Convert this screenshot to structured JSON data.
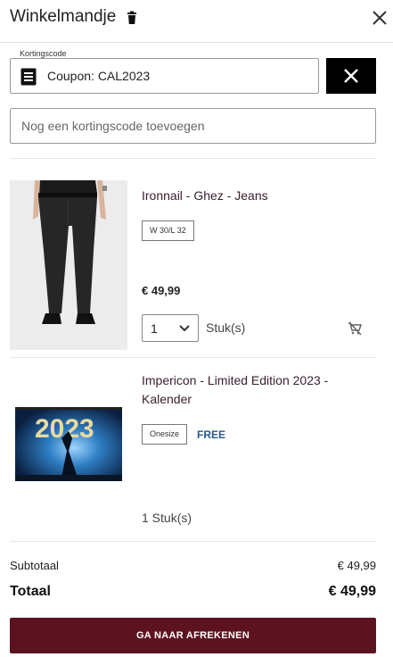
{
  "header": {
    "title": "Winkelmandje",
    "icons": [
      "trash-icon",
      "close-icon"
    ]
  },
  "coupon": {
    "legend": "Kortingscode",
    "applied": "Coupon: CAL2023",
    "icons": [
      "coupon-icon",
      "close-icon"
    ]
  },
  "code_input": {
    "placeholder": "Nog een kortingscode toevoegen",
    "value": ""
  },
  "items": [
    {
      "name": "Ironnail - Ghez - Jeans",
      "size": "W 30/L 32",
      "price": "€ 49,99",
      "quantity": "1",
      "unit": "Stuk(s)",
      "icons": [
        "jeans-product-image",
        "cart-remove-icon",
        "chevron-down-icon"
      ]
    },
    {
      "name": "Impericon - Limited Edition 2023 - Kalender",
      "size": "Onesize",
      "price_label": "FREE",
      "quantity_text": "1 Stuk(s)",
      "image_text": "2023",
      "icons": [
        "calendar-product-image"
      ]
    }
  ],
  "summary": {
    "subtotal_label": "Subtotaal",
    "subtotal_value": "€ 49,99",
    "total_label": "Totaal",
    "total_value": "€ 49,99"
  },
  "checkout_label": "GA NAAR AFREKENEN",
  "colors": {
    "checkout_bg": "#5d1220",
    "free_text": "#2a5a8a",
    "coupon_remove_bg": "#000000"
  }
}
